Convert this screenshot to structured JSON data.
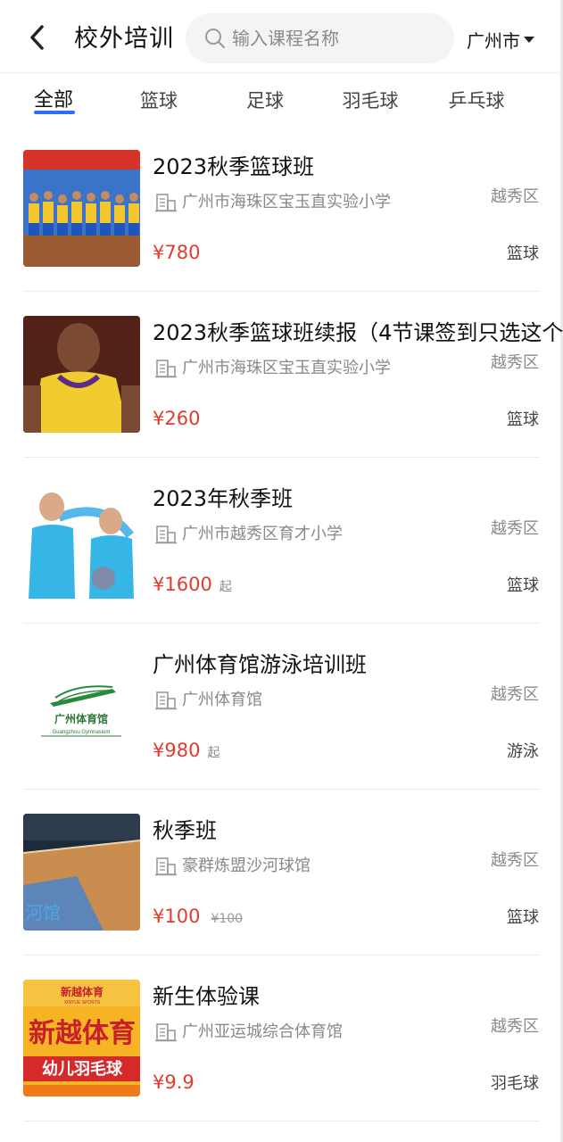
{
  "header": {
    "title": "校外培训",
    "search_placeholder": "输入课程名称",
    "city": "广州市"
  },
  "tabs": [
    {
      "label": "全部",
      "active": true
    },
    {
      "label": "篮球",
      "active": false
    },
    {
      "label": "足球",
      "active": false
    },
    {
      "label": "羽毛球",
      "active": false
    },
    {
      "label": "乒乓球",
      "active": false
    }
  ],
  "courses": [
    {
      "name": "2023秋季篮球班",
      "venue": "广州市海珠区宝玉直实验小学",
      "district": "越秀区",
      "price": "¥780",
      "price_suffix": "",
      "original_price": "",
      "category": "篮球"
    },
    {
      "name": "2023秋季篮球班续报（4节课签到只选这个",
      "venue": "广州市海珠区宝玉直实验小学",
      "district": "越秀区",
      "price": "¥260",
      "price_suffix": "",
      "original_price": "",
      "category": "篮球"
    },
    {
      "name": "2023年秋季班",
      "venue": "广州市越秀区育才小学",
      "district": "越秀区",
      "price": "¥1600",
      "price_suffix": "起",
      "original_price": "",
      "category": "篮球"
    },
    {
      "name": "广州体育馆游泳培训班",
      "venue": "广州体育馆",
      "district": "越秀区",
      "price": "¥980",
      "price_suffix": "起",
      "original_price": "",
      "category": "游泳",
      "thumb_text": "广州体育馆",
      "thumb_subtext": "Guangzhou Gymnasium"
    },
    {
      "name": "秋季班",
      "venue": "豪群炼盟沙河球馆",
      "district": "越秀区",
      "price": "¥100",
      "price_suffix": "",
      "original_price": "¥100",
      "category": "篮球",
      "thumb_text": "河馆"
    },
    {
      "name": "新生体验课",
      "venue": "广州亚运城综合体育馆",
      "district": "越秀区",
      "price": "¥9.9",
      "price_suffix": "",
      "original_price": "",
      "category": "羽毛球",
      "thumb_text": "新越体育",
      "thumb_subtext": "XINYUE SPORTS",
      "thumb_line2": "新越体育",
      "thumb_line3": "幼儿羽毛球"
    }
  ],
  "colors": {
    "accent": "#2f6bff",
    "price": "#e23b2e"
  }
}
